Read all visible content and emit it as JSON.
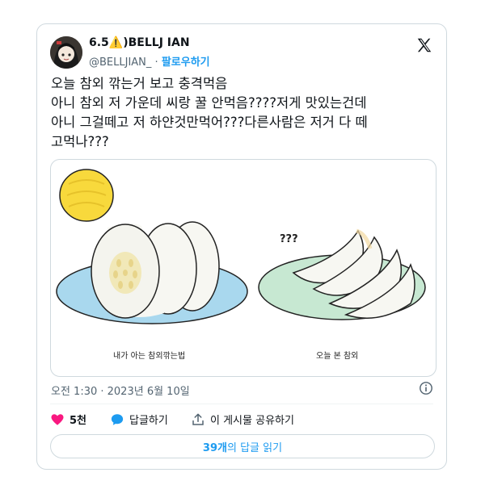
{
  "author": {
    "display_name": "6.5⚠️)BELLJ IAN",
    "handle": "@BELLJIAN_",
    "separator": "·",
    "follow_label": "팔로우하기"
  },
  "tweet": {
    "text": "오늘 참외 깎는거 보고 충격먹음\n아니 참외 저 가운데 씨랑 꿀 안먹음????저게 맛있는건데\n아니 그걸떼고 저 하얀것만먹어???다른사람은 저거 다 떼\n고먹나???"
  },
  "media": {
    "left_caption": "내가 아는 참외깎는법",
    "right_caption": "오늘 본 참외",
    "question_marks": "???"
  },
  "timestamp": "오전 1:30 · 2023년 6월 10일",
  "actions": {
    "like_count": "5천",
    "reply_label": "답글하기",
    "share_label": "이 게시물 공유하기"
  },
  "replies_button": {
    "count": "39개",
    "label": "의 답글 읽기"
  },
  "colors": {
    "accent": "#1d9bf0",
    "like": "#f91880",
    "melon_yellow": "#f8d93c",
    "plate_blue": "#a9d8ee",
    "plate_green": "#c7e8d2"
  }
}
